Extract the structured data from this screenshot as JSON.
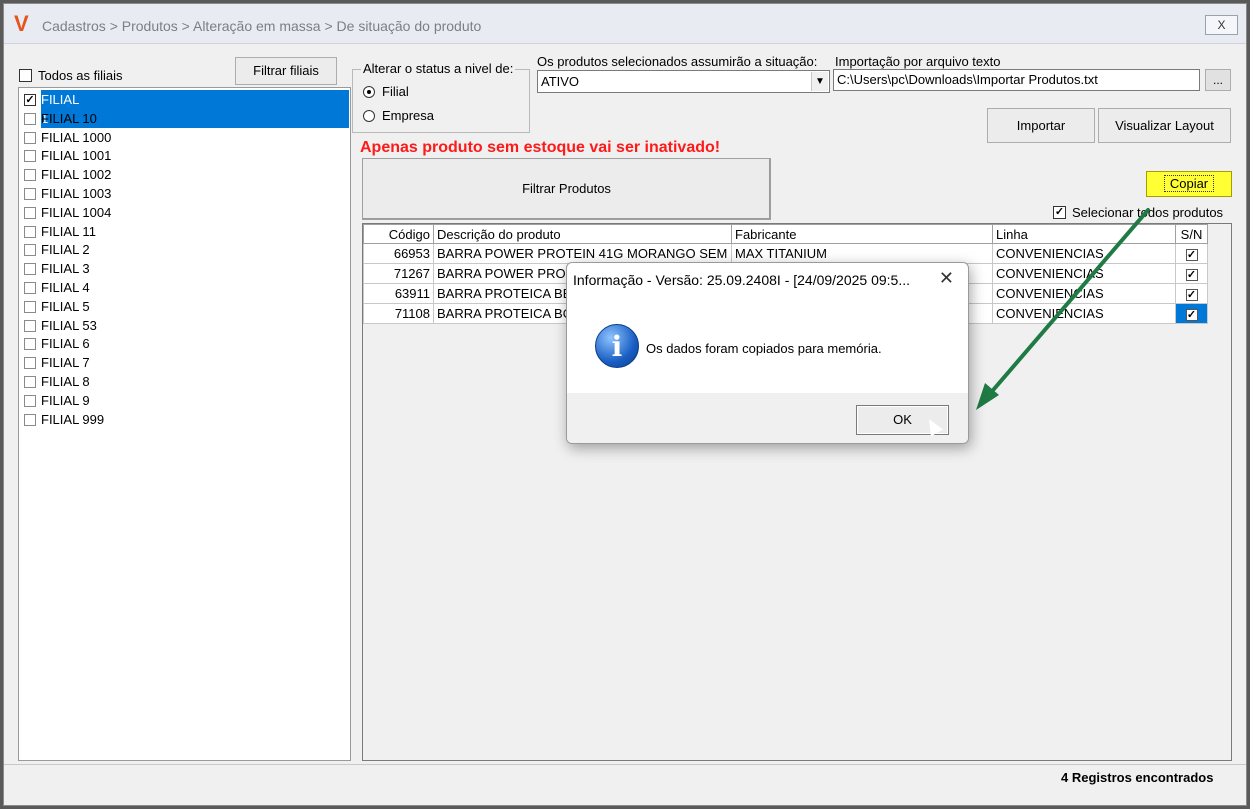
{
  "window": {
    "title": "Cadastros > Produtos > Alteração em massa > De situação do produto",
    "logo": "V",
    "close_label": "X"
  },
  "branches": {
    "all_label": "Todos as filiais",
    "filter_button": "Filtrar filiais",
    "items": [
      {
        "label": "FILIAL 1",
        "checked": true,
        "selected": true
      },
      {
        "label": "FILIAL 10"
      },
      {
        "label": "FILIAL 1000"
      },
      {
        "label": "FILIAL 1001"
      },
      {
        "label": "FILIAL 1002"
      },
      {
        "label": "FILIAL 1003"
      },
      {
        "label": "FILIAL 1004"
      },
      {
        "label": "FILIAL 11"
      },
      {
        "label": "FILIAL 2"
      },
      {
        "label": "FILIAL 3"
      },
      {
        "label": "FILIAL 4"
      },
      {
        "label": "FILIAL 5"
      },
      {
        "label": "FILIAL 53"
      },
      {
        "label": "FILIAL 6"
      },
      {
        "label": "FILIAL 7"
      },
      {
        "label": "FILIAL 8"
      },
      {
        "label": "FILIAL 9"
      },
      {
        "label": "FILIAL 999"
      }
    ]
  },
  "status_level": {
    "legend": "Alterar o status a nivel de:",
    "option_filial": "Filial",
    "option_empresa": "Empresa",
    "selected": "Filial"
  },
  "situation": {
    "label": "Os produtos selecionados assumirão a situação:",
    "value": "ATIVO"
  },
  "import": {
    "label": "Importação por arquivo texto",
    "path": "C:\\Users\\pc\\Downloads\\Importar Produtos.txt",
    "browse_label": "...",
    "import_button": "Importar",
    "layout_button": "Visualizar Layout"
  },
  "warning": "Apenas produto sem estoque vai ser inativado!",
  "filter_products_button": "Filtrar Produtos",
  "copy_button": "Copiar",
  "select_all_label": "Selecionar todos produtos",
  "grid": {
    "columns": [
      "Código",
      "Descrição do produto",
      "Fabricante",
      "Linha",
      "S/N"
    ],
    "rows": [
      {
        "code": "66953",
        "description": "BARRA POWER PROTEIN 41G MORANGO SEM",
        "maker": "MAX TITANIUM",
        "line": "CONVENIENCIAS",
        "checked": true
      },
      {
        "code": "71267",
        "description": "BARRA POWER PROT",
        "maker": "",
        "line": "CONVENIENCIAS",
        "checked": true
      },
      {
        "code": "63911",
        "description": "BARRA PROTEICA BE",
        "maker": "",
        "line": "CONVENIENCIAS",
        "checked": true
      },
      {
        "code": "71108",
        "description": "BARRA PROTEICA BO",
        "maker": "",
        "line": "CONVENIENCIAS",
        "checked": true
      }
    ]
  },
  "status_text": "4 Registros encontrados",
  "dialog": {
    "title": "Informação - Versão: 25.09.2408I - [24/09/2025 09:5...",
    "close_label": "✕",
    "icon": "info-icon",
    "message": "Os dados foram copiados para memória.",
    "ok_button": "OK"
  },
  "colors": {
    "accent": "#0078d7",
    "warning": "#ff1a1a",
    "highlight": "#ffff33",
    "annotation_arrow": "#1f7a44"
  }
}
